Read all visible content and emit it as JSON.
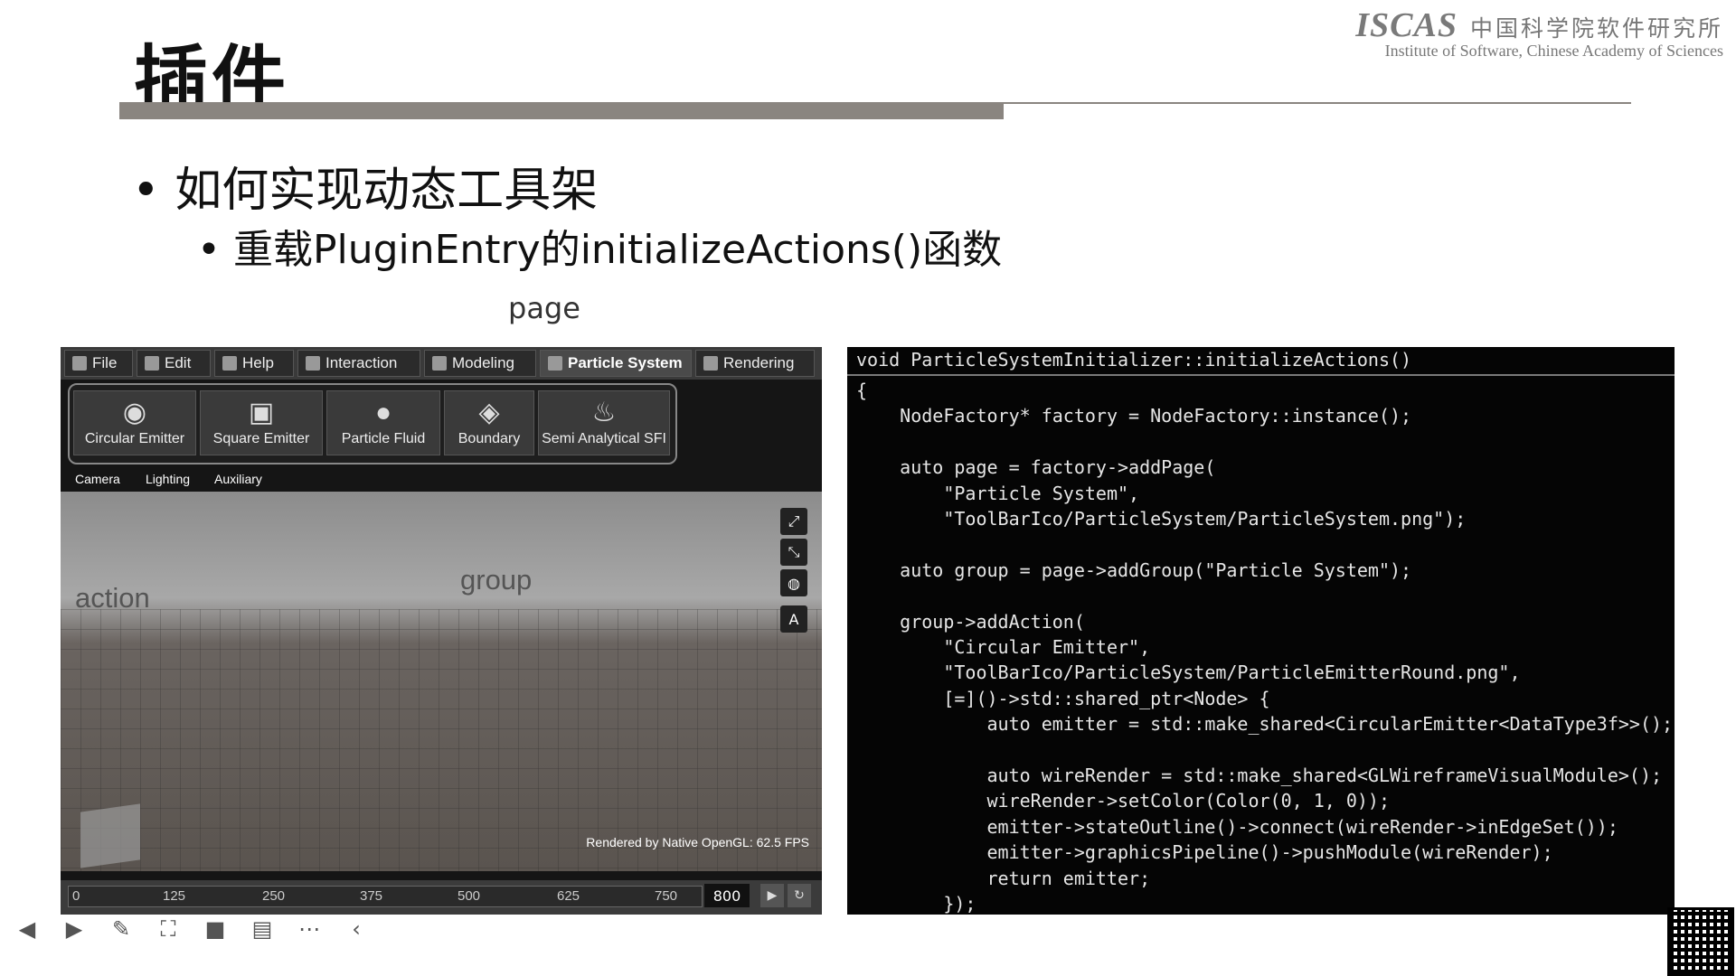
{
  "slide": {
    "title": "插件",
    "logo_mark": "ISCAS",
    "logo_cn": "中国科学院软件研究所",
    "logo_en": "Institute of Software, Chinese Academy of Sciences",
    "bullet1": "• 如何实现动态工具架",
    "bullet2": "• 重载PluginEntry的initializeActions()函数",
    "callout_page": "page",
    "callout_group": "group",
    "callout_action": "action"
  },
  "app": {
    "tabs": [
      "File",
      "Edit",
      "Help",
      "Interaction",
      "Modeling",
      "Particle System",
      "Rendering"
    ],
    "active_tab": "Particle System",
    "tools": [
      "Circular Emitter",
      "Square Emitter",
      "Particle Fluid",
      "Boundary",
      "Semi Analytical SFI"
    ],
    "groups": [
      "Camera",
      "Lighting",
      "Auxiliary"
    ],
    "side_tools": [
      "fit-icon",
      "expand-icon",
      "globe-icon",
      "A"
    ],
    "fps_text": "Rendered by Native OpenGL: 62.5 FPS",
    "timeline_ticks": [
      "0",
      "125",
      "250",
      "375",
      "500",
      "625",
      "750"
    ],
    "frame_end": "800"
  },
  "code": {
    "header": "void ParticleSystemInitializer::initializeActions()",
    "lines": [
      "{",
      "    NodeFactory* factory = NodeFactory::instance();",
      "",
      "    auto page = factory->addPage(",
      "        \"Particle System\",",
      "        \"ToolBarIco/ParticleSystem/ParticleSystem.png\");",
      "",
      "    auto group = page->addGroup(\"Particle System\");",
      "",
      "    group->addAction(",
      "        \"Circular Emitter\",",
      "        \"ToolBarIco/ParticleSystem/ParticleEmitterRound.png\",",
      "        [=]()->std::shared_ptr<Node> {",
      "            auto emitter = std::make_shared<CircularEmitter<DataType3f>>();",
      "",
      "            auto wireRender = std::make_shared<GLWireframeVisualModule>();",
      "            wireRender->setColor(Color(0, 1, 0));",
      "            emitter->stateOutline()->connect(wireRender->inEdgeSet());",
      "            emitter->graphicsPipeline()->pushModule(wireRender);",
      "            return emitter;",
      "        });"
    ]
  },
  "player": [
    "prev",
    "play",
    "pen",
    "capture",
    "camera",
    "comment",
    "more",
    "collapse"
  ]
}
